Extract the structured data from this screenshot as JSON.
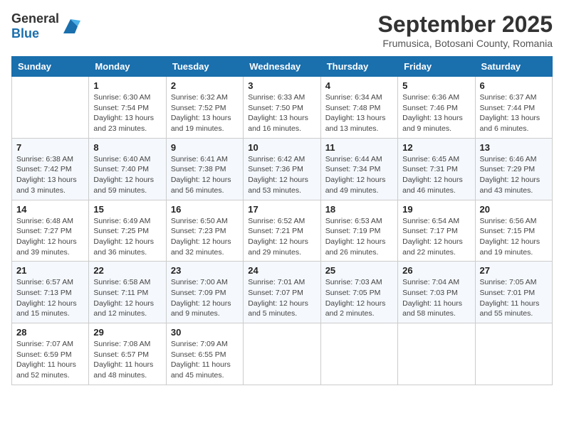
{
  "header": {
    "logo_general": "General",
    "logo_blue": "Blue",
    "month": "September 2025",
    "location": "Frumusica, Botosani County, Romania"
  },
  "days_of_week": [
    "Sunday",
    "Monday",
    "Tuesday",
    "Wednesday",
    "Thursday",
    "Friday",
    "Saturday"
  ],
  "weeks": [
    [
      {
        "day": "",
        "sunrise": "",
        "sunset": "",
        "daylight": ""
      },
      {
        "day": "1",
        "sunrise": "Sunrise: 6:30 AM",
        "sunset": "Sunset: 7:54 PM",
        "daylight": "Daylight: 13 hours and 23 minutes."
      },
      {
        "day": "2",
        "sunrise": "Sunrise: 6:32 AM",
        "sunset": "Sunset: 7:52 PM",
        "daylight": "Daylight: 13 hours and 19 minutes."
      },
      {
        "day": "3",
        "sunrise": "Sunrise: 6:33 AM",
        "sunset": "Sunset: 7:50 PM",
        "daylight": "Daylight: 13 hours and 16 minutes."
      },
      {
        "day": "4",
        "sunrise": "Sunrise: 6:34 AM",
        "sunset": "Sunset: 7:48 PM",
        "daylight": "Daylight: 13 hours and 13 minutes."
      },
      {
        "day": "5",
        "sunrise": "Sunrise: 6:36 AM",
        "sunset": "Sunset: 7:46 PM",
        "daylight": "Daylight: 13 hours and 9 minutes."
      },
      {
        "day": "6",
        "sunrise": "Sunrise: 6:37 AM",
        "sunset": "Sunset: 7:44 PM",
        "daylight": "Daylight: 13 hours and 6 minutes."
      }
    ],
    [
      {
        "day": "7",
        "sunrise": "Sunrise: 6:38 AM",
        "sunset": "Sunset: 7:42 PM",
        "daylight": "Daylight: 13 hours and 3 minutes."
      },
      {
        "day": "8",
        "sunrise": "Sunrise: 6:40 AM",
        "sunset": "Sunset: 7:40 PM",
        "daylight": "Daylight: 12 hours and 59 minutes."
      },
      {
        "day": "9",
        "sunrise": "Sunrise: 6:41 AM",
        "sunset": "Sunset: 7:38 PM",
        "daylight": "Daylight: 12 hours and 56 minutes."
      },
      {
        "day": "10",
        "sunrise": "Sunrise: 6:42 AM",
        "sunset": "Sunset: 7:36 PM",
        "daylight": "Daylight: 12 hours and 53 minutes."
      },
      {
        "day": "11",
        "sunrise": "Sunrise: 6:44 AM",
        "sunset": "Sunset: 7:34 PM",
        "daylight": "Daylight: 12 hours and 49 minutes."
      },
      {
        "day": "12",
        "sunrise": "Sunrise: 6:45 AM",
        "sunset": "Sunset: 7:31 PM",
        "daylight": "Daylight: 12 hours and 46 minutes."
      },
      {
        "day": "13",
        "sunrise": "Sunrise: 6:46 AM",
        "sunset": "Sunset: 7:29 PM",
        "daylight": "Daylight: 12 hours and 43 minutes."
      }
    ],
    [
      {
        "day": "14",
        "sunrise": "Sunrise: 6:48 AM",
        "sunset": "Sunset: 7:27 PM",
        "daylight": "Daylight: 12 hours and 39 minutes."
      },
      {
        "day": "15",
        "sunrise": "Sunrise: 6:49 AM",
        "sunset": "Sunset: 7:25 PM",
        "daylight": "Daylight: 12 hours and 36 minutes."
      },
      {
        "day": "16",
        "sunrise": "Sunrise: 6:50 AM",
        "sunset": "Sunset: 7:23 PM",
        "daylight": "Daylight: 12 hours and 32 minutes."
      },
      {
        "day": "17",
        "sunrise": "Sunrise: 6:52 AM",
        "sunset": "Sunset: 7:21 PM",
        "daylight": "Daylight: 12 hours and 29 minutes."
      },
      {
        "day": "18",
        "sunrise": "Sunrise: 6:53 AM",
        "sunset": "Sunset: 7:19 PM",
        "daylight": "Daylight: 12 hours and 26 minutes."
      },
      {
        "day": "19",
        "sunrise": "Sunrise: 6:54 AM",
        "sunset": "Sunset: 7:17 PM",
        "daylight": "Daylight: 12 hours and 22 minutes."
      },
      {
        "day": "20",
        "sunrise": "Sunrise: 6:56 AM",
        "sunset": "Sunset: 7:15 PM",
        "daylight": "Daylight: 12 hours and 19 minutes."
      }
    ],
    [
      {
        "day": "21",
        "sunrise": "Sunrise: 6:57 AM",
        "sunset": "Sunset: 7:13 PM",
        "daylight": "Daylight: 12 hours and 15 minutes."
      },
      {
        "day": "22",
        "sunrise": "Sunrise: 6:58 AM",
        "sunset": "Sunset: 7:11 PM",
        "daylight": "Daylight: 12 hours and 12 minutes."
      },
      {
        "day": "23",
        "sunrise": "Sunrise: 7:00 AM",
        "sunset": "Sunset: 7:09 PM",
        "daylight": "Daylight: 12 hours and 9 minutes."
      },
      {
        "day": "24",
        "sunrise": "Sunrise: 7:01 AM",
        "sunset": "Sunset: 7:07 PM",
        "daylight": "Daylight: 12 hours and 5 minutes."
      },
      {
        "day": "25",
        "sunrise": "Sunrise: 7:03 AM",
        "sunset": "Sunset: 7:05 PM",
        "daylight": "Daylight: 12 hours and 2 minutes."
      },
      {
        "day": "26",
        "sunrise": "Sunrise: 7:04 AM",
        "sunset": "Sunset: 7:03 PM",
        "daylight": "Daylight: 11 hours and 58 minutes."
      },
      {
        "day": "27",
        "sunrise": "Sunrise: 7:05 AM",
        "sunset": "Sunset: 7:01 PM",
        "daylight": "Daylight: 11 hours and 55 minutes."
      }
    ],
    [
      {
        "day": "28",
        "sunrise": "Sunrise: 7:07 AM",
        "sunset": "Sunset: 6:59 PM",
        "daylight": "Daylight: 11 hours and 52 minutes."
      },
      {
        "day": "29",
        "sunrise": "Sunrise: 7:08 AM",
        "sunset": "Sunset: 6:57 PM",
        "daylight": "Daylight: 11 hours and 48 minutes."
      },
      {
        "day": "30",
        "sunrise": "Sunrise: 7:09 AM",
        "sunset": "Sunset: 6:55 PM",
        "daylight": "Daylight: 11 hours and 45 minutes."
      },
      {
        "day": "",
        "sunrise": "",
        "sunset": "",
        "daylight": ""
      },
      {
        "day": "",
        "sunrise": "",
        "sunset": "",
        "daylight": ""
      },
      {
        "day": "",
        "sunrise": "",
        "sunset": "",
        "daylight": ""
      },
      {
        "day": "",
        "sunrise": "",
        "sunset": "",
        "daylight": ""
      }
    ]
  ]
}
